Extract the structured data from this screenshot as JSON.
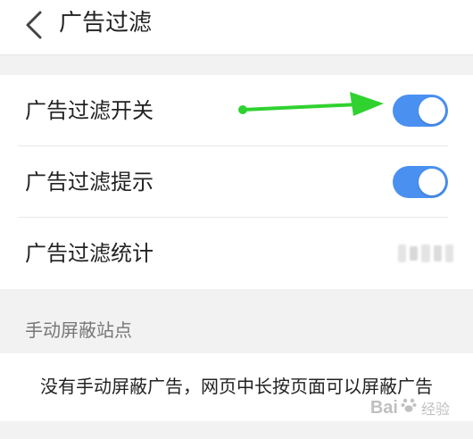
{
  "header": {
    "title": "广告过滤",
    "back_icon": "chevron-left-icon"
  },
  "settings": {
    "items": [
      {
        "label": "广告过滤开关",
        "control": "toggle",
        "on": true
      },
      {
        "label": "广告过滤提示",
        "control": "toggle",
        "on": true
      },
      {
        "label": "广告过滤统计",
        "control": "blurred-value"
      }
    ]
  },
  "manual_block": {
    "section_title": "手动屏蔽站点",
    "empty_text": "没有手动屏蔽广告，网页中长按页面可以屏蔽广告"
  },
  "watermark": {
    "brand_a": "Bai",
    "brand_b": "经验"
  },
  "colors": {
    "toggle_on": "#4a90f0",
    "arrow": "#2fd22f",
    "page_bg": "#f2f2f2"
  }
}
